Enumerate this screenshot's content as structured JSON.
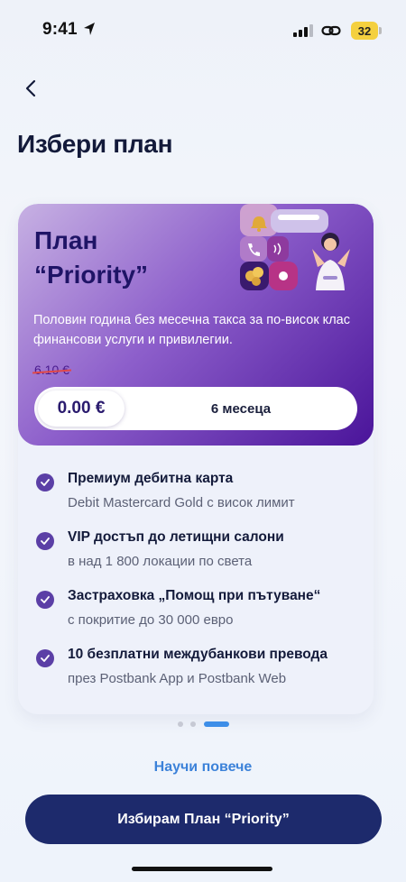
{
  "status_bar": {
    "time": "9:41",
    "battery": "32"
  },
  "header": {
    "title": "Избери план"
  },
  "plan": {
    "title_line1": "План",
    "title_line2": "“Priority”",
    "description": "Половин година без месечна такса за по-висок клас финансови услуги и привилегии.",
    "old_price": "6.10 €",
    "price": "0.00 €",
    "period": "6 месеца"
  },
  "features": [
    {
      "title": "Премиум дебитна карта",
      "subtitle": "Debit Mastercard Gold с висок лимит"
    },
    {
      "title": "VIP достъп до летищни салони",
      "subtitle": "в над 1 800 локации по света"
    },
    {
      "title": "Застраховка „Помощ при пътуване“",
      "subtitle": "с покритие до 30 000 евро"
    },
    {
      "title": "10 безплатни междубанкови превода",
      "subtitle": "през Postbank App и Postbank Web"
    }
  ],
  "pagination": {
    "total": 3,
    "active": 3
  },
  "links": {
    "learn_more": "Научи повече"
  },
  "cta": {
    "label": "Избирам План “Priority”"
  },
  "colors": {
    "accent": "#5b3fa6",
    "cta_bg": "#1d2a6c",
    "link": "#3c82d9",
    "hero_dark": "#4a149a"
  },
  "icons": [
    "location-arrow-icon",
    "signal-icon",
    "link-icon",
    "battery-icon",
    "back-chevron-icon",
    "check-icon",
    "bell-icon",
    "phone-icon",
    "coins-icon",
    "contactless-icon"
  ]
}
